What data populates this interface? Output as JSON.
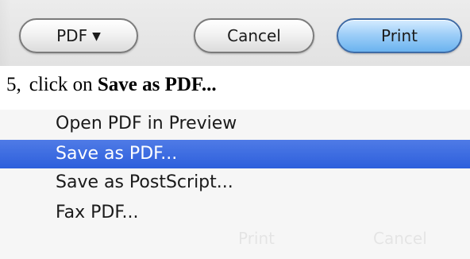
{
  "toolbar": {
    "pdf_button": {
      "label": "PDF",
      "arrow": "▼"
    },
    "cancel_button": {
      "label": "Cancel"
    },
    "print_button": {
      "label": "Print",
      "default": true
    }
  },
  "instruction": {
    "step": "5,",
    "text": "click on",
    "target": "Save as PDF..."
  },
  "pdf_menu": {
    "items": [
      {
        "label": "Open PDF in Preview",
        "selected": false
      },
      {
        "label": "Save as PDF...",
        "selected": true
      },
      {
        "label": "Save as PostScript...",
        "selected": false
      },
      {
        "label": "Fax PDF...",
        "selected": false
      }
    ],
    "ghost_print": "Print",
    "ghost_cancel": "Cancel"
  },
  "colors": {
    "selection": "#3a68e0",
    "default_button": "#8cc4f5",
    "toolbar_bg": "#e6e6e6"
  }
}
